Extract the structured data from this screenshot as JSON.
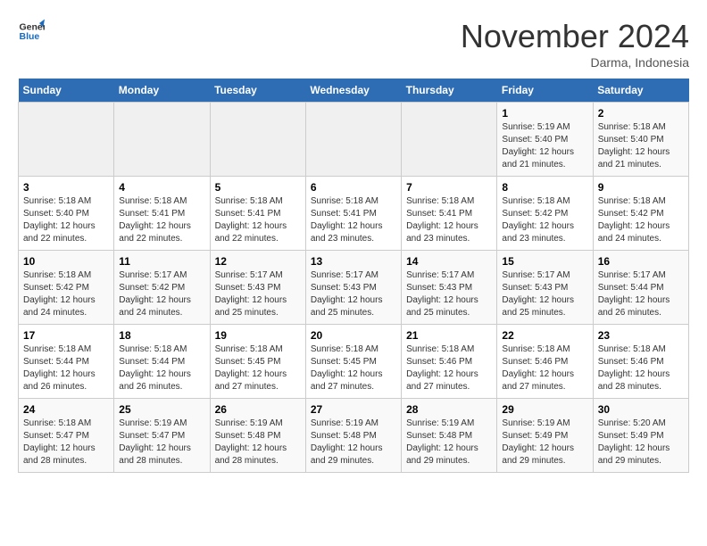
{
  "logo": {
    "line1": "General",
    "line2": "Blue"
  },
  "title": "November 2024",
  "subtitle": "Darma, Indonesia",
  "weekdays": [
    "Sunday",
    "Monday",
    "Tuesday",
    "Wednesday",
    "Thursday",
    "Friday",
    "Saturday"
  ],
  "weeks": [
    [
      {
        "day": "",
        "info": ""
      },
      {
        "day": "",
        "info": ""
      },
      {
        "day": "",
        "info": ""
      },
      {
        "day": "",
        "info": ""
      },
      {
        "day": "",
        "info": ""
      },
      {
        "day": "1",
        "info": "Sunrise: 5:19 AM\nSunset: 5:40 PM\nDaylight: 12 hours\nand 21 minutes."
      },
      {
        "day": "2",
        "info": "Sunrise: 5:18 AM\nSunset: 5:40 PM\nDaylight: 12 hours\nand 21 minutes."
      }
    ],
    [
      {
        "day": "3",
        "info": "Sunrise: 5:18 AM\nSunset: 5:40 PM\nDaylight: 12 hours\nand 22 minutes."
      },
      {
        "day": "4",
        "info": "Sunrise: 5:18 AM\nSunset: 5:41 PM\nDaylight: 12 hours\nand 22 minutes."
      },
      {
        "day": "5",
        "info": "Sunrise: 5:18 AM\nSunset: 5:41 PM\nDaylight: 12 hours\nand 22 minutes."
      },
      {
        "day": "6",
        "info": "Sunrise: 5:18 AM\nSunset: 5:41 PM\nDaylight: 12 hours\nand 23 minutes."
      },
      {
        "day": "7",
        "info": "Sunrise: 5:18 AM\nSunset: 5:41 PM\nDaylight: 12 hours\nand 23 minutes."
      },
      {
        "day": "8",
        "info": "Sunrise: 5:18 AM\nSunset: 5:42 PM\nDaylight: 12 hours\nand 23 minutes."
      },
      {
        "day": "9",
        "info": "Sunrise: 5:18 AM\nSunset: 5:42 PM\nDaylight: 12 hours\nand 24 minutes."
      }
    ],
    [
      {
        "day": "10",
        "info": "Sunrise: 5:18 AM\nSunset: 5:42 PM\nDaylight: 12 hours\nand 24 minutes."
      },
      {
        "day": "11",
        "info": "Sunrise: 5:17 AM\nSunset: 5:42 PM\nDaylight: 12 hours\nand 24 minutes."
      },
      {
        "day": "12",
        "info": "Sunrise: 5:17 AM\nSunset: 5:43 PM\nDaylight: 12 hours\nand 25 minutes."
      },
      {
        "day": "13",
        "info": "Sunrise: 5:17 AM\nSunset: 5:43 PM\nDaylight: 12 hours\nand 25 minutes."
      },
      {
        "day": "14",
        "info": "Sunrise: 5:17 AM\nSunset: 5:43 PM\nDaylight: 12 hours\nand 25 minutes."
      },
      {
        "day": "15",
        "info": "Sunrise: 5:17 AM\nSunset: 5:43 PM\nDaylight: 12 hours\nand 25 minutes."
      },
      {
        "day": "16",
        "info": "Sunrise: 5:17 AM\nSunset: 5:44 PM\nDaylight: 12 hours\nand 26 minutes."
      }
    ],
    [
      {
        "day": "17",
        "info": "Sunrise: 5:18 AM\nSunset: 5:44 PM\nDaylight: 12 hours\nand 26 minutes."
      },
      {
        "day": "18",
        "info": "Sunrise: 5:18 AM\nSunset: 5:44 PM\nDaylight: 12 hours\nand 26 minutes."
      },
      {
        "day": "19",
        "info": "Sunrise: 5:18 AM\nSunset: 5:45 PM\nDaylight: 12 hours\nand 27 minutes."
      },
      {
        "day": "20",
        "info": "Sunrise: 5:18 AM\nSunset: 5:45 PM\nDaylight: 12 hours\nand 27 minutes."
      },
      {
        "day": "21",
        "info": "Sunrise: 5:18 AM\nSunset: 5:46 PM\nDaylight: 12 hours\nand 27 minutes."
      },
      {
        "day": "22",
        "info": "Sunrise: 5:18 AM\nSunset: 5:46 PM\nDaylight: 12 hours\nand 27 minutes."
      },
      {
        "day": "23",
        "info": "Sunrise: 5:18 AM\nSunset: 5:46 PM\nDaylight: 12 hours\nand 28 minutes."
      }
    ],
    [
      {
        "day": "24",
        "info": "Sunrise: 5:18 AM\nSunset: 5:47 PM\nDaylight: 12 hours\nand 28 minutes."
      },
      {
        "day": "25",
        "info": "Sunrise: 5:19 AM\nSunset: 5:47 PM\nDaylight: 12 hours\nand 28 minutes."
      },
      {
        "day": "26",
        "info": "Sunrise: 5:19 AM\nSunset: 5:48 PM\nDaylight: 12 hours\nand 28 minutes."
      },
      {
        "day": "27",
        "info": "Sunrise: 5:19 AM\nSunset: 5:48 PM\nDaylight: 12 hours\nand 29 minutes."
      },
      {
        "day": "28",
        "info": "Sunrise: 5:19 AM\nSunset: 5:48 PM\nDaylight: 12 hours\nand 29 minutes."
      },
      {
        "day": "29",
        "info": "Sunrise: 5:19 AM\nSunset: 5:49 PM\nDaylight: 12 hours\nand 29 minutes."
      },
      {
        "day": "30",
        "info": "Sunrise: 5:20 AM\nSunset: 5:49 PM\nDaylight: 12 hours\nand 29 minutes."
      }
    ]
  ]
}
